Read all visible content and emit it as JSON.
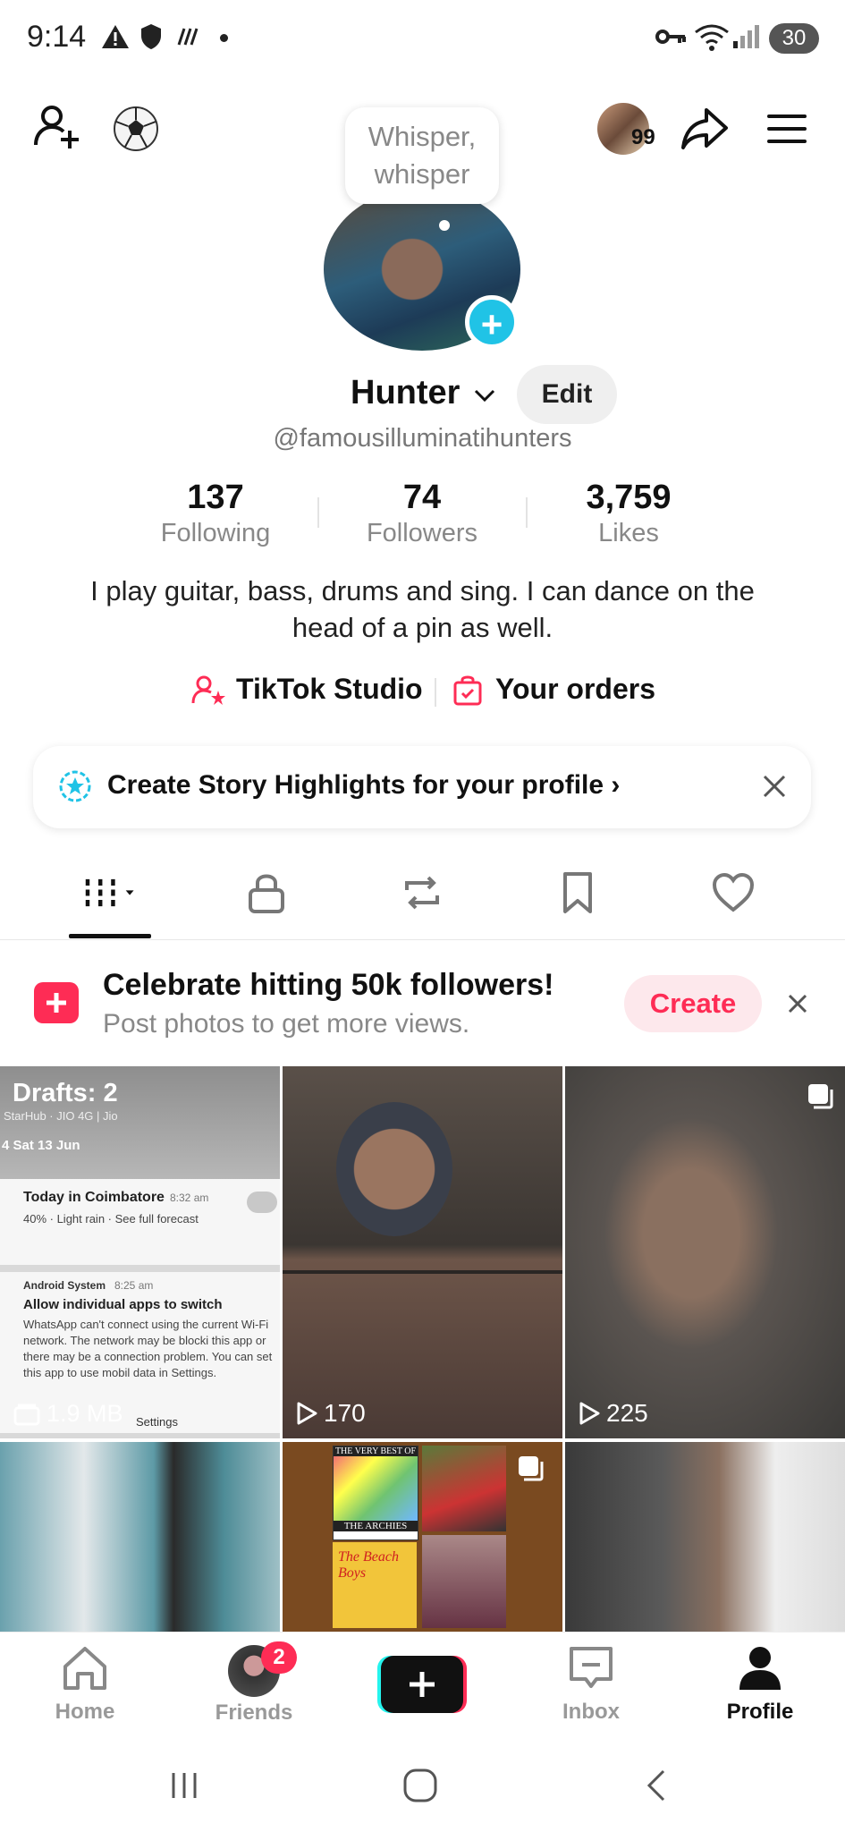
{
  "status_bar": {
    "time": "9:14",
    "battery": "30"
  },
  "top_bar": {
    "badge_count": "99"
  },
  "profile": {
    "status_bubble": "Whisper, whisper",
    "name": "Hunter",
    "edit_label": "Edit",
    "handle": "@famousilluminatihunters",
    "stats": [
      {
        "num": "137",
        "label": "Following"
      },
      {
        "num": "74",
        "label": "Followers"
      },
      {
        "num": "3,759",
        "label": "Likes"
      }
    ],
    "bio": "I play guitar, bass, drums and sing. I can dance on the head of a pin as well.",
    "links": {
      "studio": "TikTok Studio",
      "orders": "Your orders"
    }
  },
  "story_banner": {
    "text": "Create Story Highlights for your profile"
  },
  "promo": {
    "title": "Celebrate hitting 50k followers!",
    "subtitle": "Post photos to get more views.",
    "button": "Create"
  },
  "grid": {
    "drafts_title": "Drafts: 2",
    "drafts_size": "1.9 MB",
    "drafts_preview": {
      "carrier": "StarHub · JIO 4G | Jio",
      "date": "4 Sat 13 Jun",
      "n1_title": "Today in Coimbatore",
      "n1_time": "8:32 am",
      "n1_body": "40% · Light rain · See full forecast",
      "n2_app": "Android System",
      "n2_time": "8:25 am",
      "n2_title": "Allow individual apps to switch",
      "n2_body": "WhatsApp can't connect using the current Wi-Fi network. The network may be blocki this app or there may be a connection problem. You can set this app to use mobil data in Settings.",
      "n2_action": "Settings"
    },
    "tiles": [
      {
        "views": "170"
      },
      {
        "views": "225"
      }
    ],
    "album_top": "THE VERY BEST OF",
    "album_name": "THE ARCHIES",
    "album_beach": "The Beach Boys"
  },
  "nav": {
    "home": "Home",
    "friends": "Friends",
    "friends_badge": "2",
    "inbox": "Inbox",
    "profile": "Profile"
  },
  "colors": {
    "accent": "#fe2c55",
    "cyan": "#20c3e6"
  }
}
